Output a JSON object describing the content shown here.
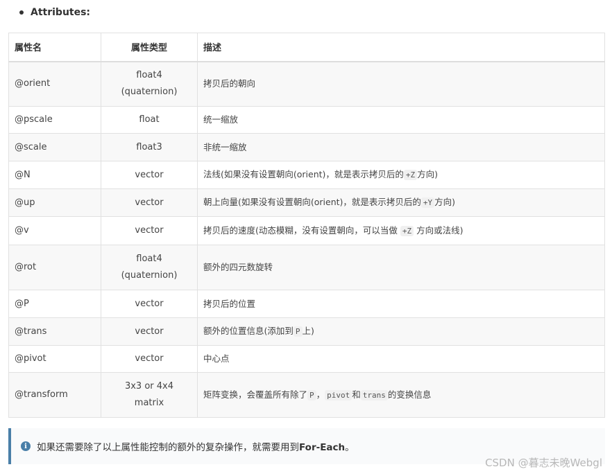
{
  "section": {
    "bullet_label": "Attributes:"
  },
  "table": {
    "headers": [
      "属性名",
      "属性类型",
      "描述"
    ],
    "rows": [
      {
        "name": "@orient",
        "type_lines": [
          "float4",
          "(quaternion)"
        ],
        "desc": [
          {
            "t": "拷贝后的朝向"
          }
        ]
      },
      {
        "name": "@pscale",
        "type_lines": [
          "float"
        ],
        "desc": [
          {
            "t": "统一缩放"
          }
        ]
      },
      {
        "name": "@scale",
        "type_lines": [
          "float3"
        ],
        "desc": [
          {
            "t": "非统一缩放"
          }
        ]
      },
      {
        "name": "@N",
        "type_lines": [
          "vector"
        ],
        "desc": [
          {
            "t": "法线(如果没有设置朝向(orient)，就是表示拷贝后的"
          },
          {
            "code": "+Z"
          },
          {
            "t": "方向)"
          }
        ]
      },
      {
        "name": "@up",
        "type_lines": [
          "vector"
        ],
        "desc": [
          {
            "t": "朝上向量(如果没有设置朝向(orient)，就是表示拷贝后的"
          },
          {
            "code": "+Y"
          },
          {
            "t": "方向)"
          }
        ]
      },
      {
        "name": "@v",
        "type_lines": [
          "vector"
        ],
        "desc": [
          {
            "t": "拷贝后的速度(动态模糊，没有设置朝向，可以当做 "
          },
          {
            "code": "+Z"
          },
          {
            "t": " 方向或法线)"
          }
        ]
      },
      {
        "name": "@rot",
        "type_lines": [
          "float4",
          "(quaternion)"
        ],
        "desc": [
          {
            "t": "额外的四元数旋转"
          }
        ]
      },
      {
        "name": "@P",
        "type_lines": [
          "vector"
        ],
        "desc": [
          {
            "t": "拷贝后的位置"
          }
        ]
      },
      {
        "name": "@trans",
        "type_lines": [
          "vector"
        ],
        "desc": [
          {
            "t": "额外的位置信息(添加到"
          },
          {
            "code": "P"
          },
          {
            "t": "上)"
          }
        ]
      },
      {
        "name": "@pivot",
        "type_lines": [
          "vector"
        ],
        "desc": [
          {
            "t": "中心点"
          }
        ]
      },
      {
        "name": "@transform",
        "type_lines": [
          "3x3 or 4x4",
          "matrix"
        ],
        "desc": [
          {
            "t": "矩阵变换，会覆盖所有除了"
          },
          {
            "code": "P"
          },
          {
            "t": "，"
          },
          {
            "code": "pivot"
          },
          {
            "t": "和"
          },
          {
            "code": "trans"
          },
          {
            "t": "的变换信息"
          }
        ]
      }
    ]
  },
  "info": {
    "icon": "info-icon",
    "icon_glyph": "i",
    "text": "如果还需要除了以上属性能控制的额外的复杂操作，就需要用到",
    "strong": "For-Each",
    "suffix": "。",
    "accent_color": "#4a7fa8"
  },
  "watermark": "CSDN @暮志未晚Webgl"
}
